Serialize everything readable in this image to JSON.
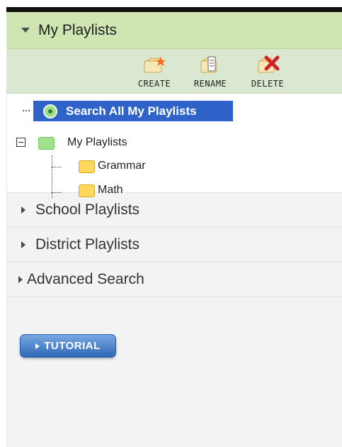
{
  "header": {
    "title": "My Playlists"
  },
  "toolbar": {
    "create_label": "CREATE",
    "rename_label": "RENAME",
    "delete_label": "DELETE"
  },
  "tree": {
    "search_all": "Search All My Playlists",
    "root": "My Playlists",
    "children": [
      "Grammar",
      "Math"
    ]
  },
  "sections": [
    {
      "label": "School Playlists"
    },
    {
      "label": "District Playlists"
    },
    {
      "label": "Advanced Search"
    }
  ],
  "tutorial": {
    "label": "TUTORIAL"
  },
  "colors": {
    "header_bg": "#cfe5b2",
    "selection_bg": "#2f63c9",
    "tutorial_bg": "#2f67b8"
  }
}
